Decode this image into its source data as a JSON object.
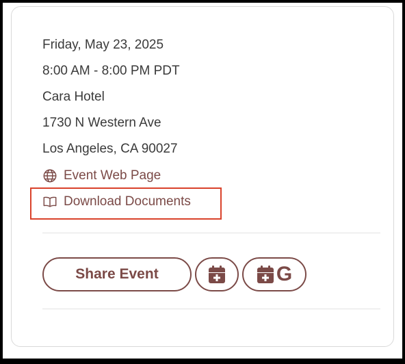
{
  "event": {
    "date": "Friday, May 23, 2025",
    "time": "8:00 AM - 8:00 PM PDT",
    "venue": "Cara Hotel",
    "street": "1730 N Western Ave",
    "city": "Los Angeles, CA 90027"
  },
  "links": {
    "web_page": {
      "label": "Event Web Page",
      "icon": "globe-icon"
    },
    "documents": {
      "label": "Download Documents",
      "icon": "book-icon"
    }
  },
  "actions": {
    "share_label": "Share Event",
    "calendar_icon": "calendar-add-icon",
    "google_calendar_letter": "G"
  },
  "colors": {
    "accent": "#7b4a47",
    "highlight": "#d9412a",
    "text": "#3a3a3a"
  }
}
